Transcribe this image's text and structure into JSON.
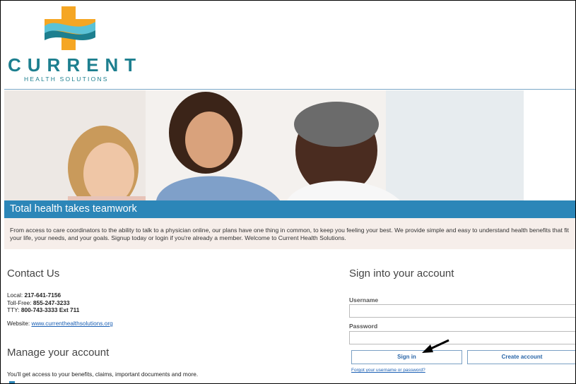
{
  "brand": {
    "name": "CURRENT",
    "tagline": "HEALTH SOLUTIONS",
    "colors": {
      "teal": "#1d7f8f",
      "blue": "#2c86b8",
      "orange": "#f5a623"
    }
  },
  "hero": {
    "caption": "Total health takes teamwork",
    "description": "From access to care coordinators to the ability to talk to a physician online, our plans have one thing in common, to keep you feeling your best. We provide simple and easy to understand health benefits that fit your life, your needs, and your goals. Signup today or login if you're already a member. Welcome to Current Health Solutions."
  },
  "contact": {
    "title": "Contact Us",
    "local_label": "Local:",
    "local": "217-641-7156",
    "tollfree_label": "Toll-Free:",
    "tollfree": "855-247-3233",
    "tty_label": "TTY:",
    "tty": "800-743-3333 Ext 711",
    "website_label": "Website:",
    "website": "www.currenthealthsolutions.org"
  },
  "manage": {
    "title": "Manage your account",
    "description": "You'll get access to your benefits, claims, important documents and more."
  },
  "signin": {
    "title": "Sign into your account",
    "username_label": "Username",
    "username_value": "",
    "password_label": "Password",
    "password_value": "",
    "signin_button": "Sign in",
    "create_button": "Create account",
    "forgot_link": "Forgot your username or password?"
  }
}
